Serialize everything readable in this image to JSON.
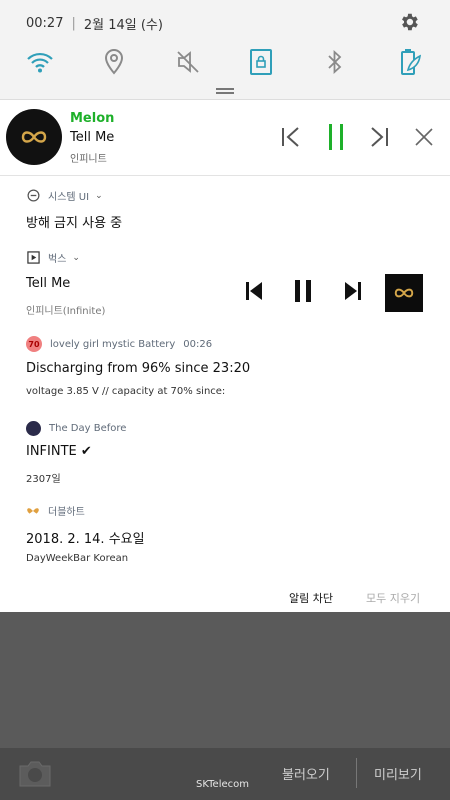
{
  "status": {
    "time": "00:27",
    "date": "2월 14일 (수)"
  },
  "icons": {
    "settings": "gear-icon",
    "wifi": "wifi-icon",
    "location": "location-icon",
    "sound": "mute-icon",
    "lock": "rotation-lock-icon",
    "bluetooth": "bluetooth-icon",
    "power": "power-saving-icon"
  },
  "colors": {
    "accent": "#2f9fb9",
    "melon_green": "#1eb02a",
    "panel_bg": "#f3f3f3"
  },
  "melon": {
    "app": "Melon",
    "title": "Tell Me",
    "artist": "인피니트"
  },
  "notifications": {
    "system": {
      "app": "시스템 UI",
      "text": "방해 금지 사용 중"
    },
    "bugs": {
      "app": "벅스",
      "title": "Tell Me",
      "artist": "인피니트(Infinite)"
    },
    "battery": {
      "badge": "70",
      "app": "lovely girl mystic Battery",
      "time": "00:26",
      "text": "Discharging from 96% since 23:20",
      "detail": "voltage 3.85 V // capacity at 70% since:"
    },
    "dayBefore": {
      "app": "The Day Before",
      "text": "INFINTE ✔",
      "detail": "2307일"
    },
    "couple": {
      "app": "더블하트",
      "text": "2018. 2. 14. 수요일",
      "detail": "DayWeekBar Korean"
    }
  },
  "actions": {
    "block": "알림 차단",
    "clear": "모두 지우기"
  },
  "bottom": {
    "carrier": "SKTelecom",
    "load": "불러오기",
    "preview": "미리보기"
  }
}
